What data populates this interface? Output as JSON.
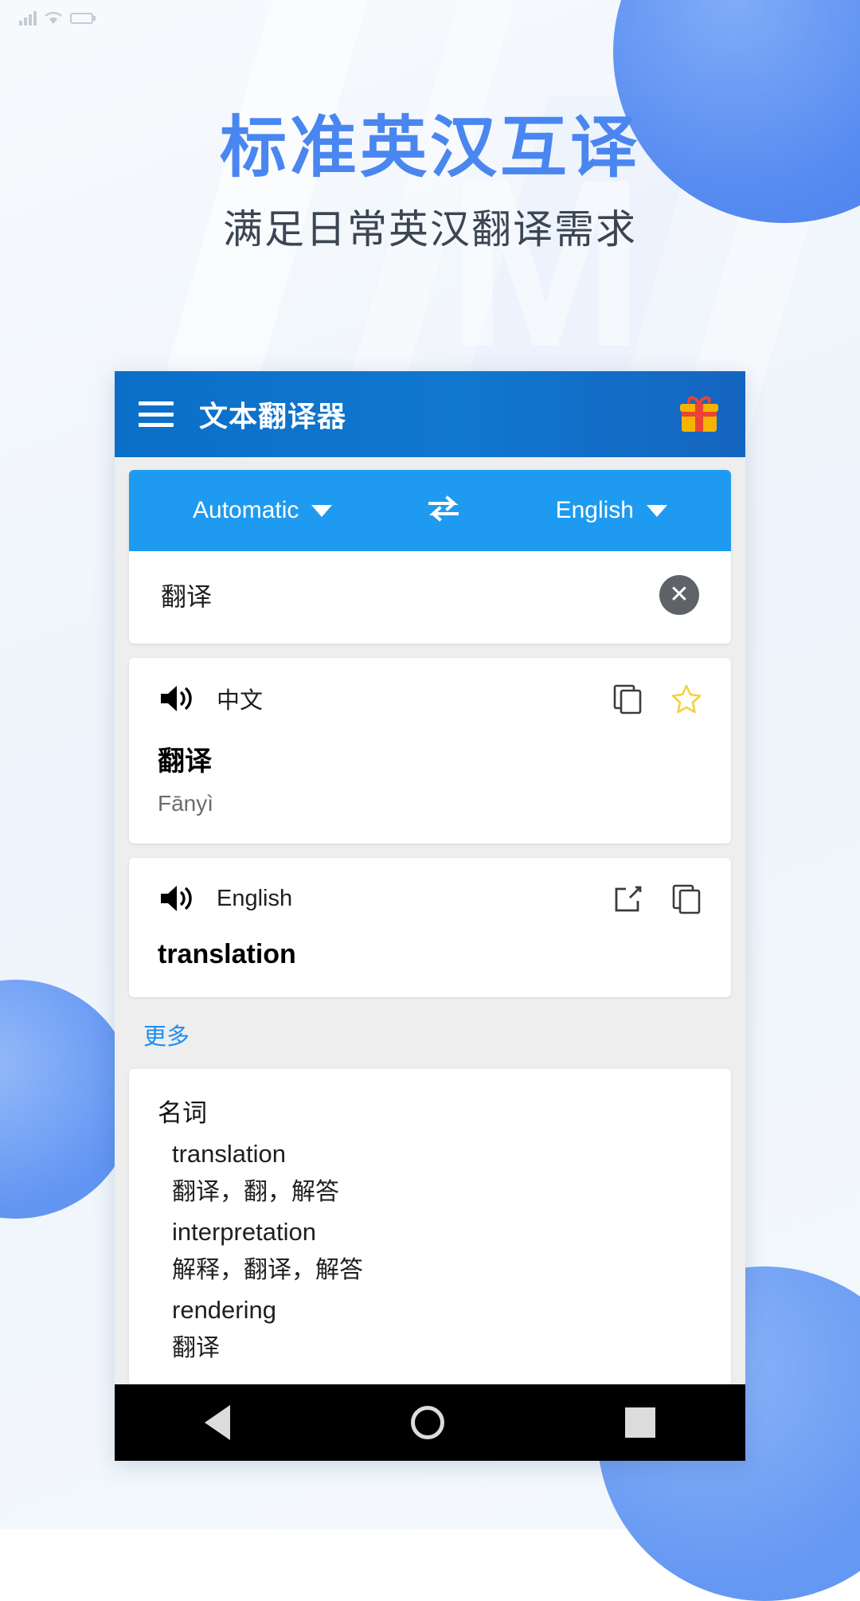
{
  "promo": {
    "title": "标准英汉互译",
    "subtitle": "满足日常英汉翻译需求",
    "title_color": "#4a86f0",
    "subtitle_color": "#3b4654"
  },
  "status_bar": {
    "signal_icon": "signal-bars-icon",
    "wifi_icon": "wifi-icon",
    "battery_icon": "battery-icon"
  },
  "app_bar": {
    "menu_icon": "hamburger-menu-icon",
    "title": "文本翻译器",
    "gift_icon": "gift-icon",
    "background_color": "#1077cf"
  },
  "language_bar": {
    "source": "Automatic",
    "target": "English",
    "swap_icon": "swap-arrows-icon",
    "dropdown_icon": "caret-down-icon",
    "background_color": "#1e9bf0"
  },
  "input": {
    "text": "翻译",
    "placeholder": "",
    "clear_icon": "clear-circle-icon"
  },
  "results": [
    {
      "speaker_icon": "speaker-icon",
      "language": "中文",
      "text": "翻译",
      "pinyin": "Fānyì",
      "actions": [
        "copy-icon",
        "star-icon"
      ]
    },
    {
      "speaker_icon": "speaker-icon",
      "language": "English",
      "text": "translation",
      "pinyin": "",
      "actions": [
        "open-external-icon",
        "copy-icon"
      ]
    }
  ],
  "more": {
    "label": "更多",
    "color": "#1e8ef0"
  },
  "dictionary": {
    "part_of_speech": "名词",
    "entries": [
      {
        "term": "translation",
        "gloss": "翻译，翻，解答"
      },
      {
        "term": "interpretation",
        "gloss": "解释，翻译，解答"
      },
      {
        "term": "rendering",
        "gloss": "翻译"
      }
    ]
  },
  "nav_bar": {
    "back_icon": "back-triangle-icon",
    "home_icon": "home-circle-icon",
    "recents_icon": "recents-square-icon"
  }
}
